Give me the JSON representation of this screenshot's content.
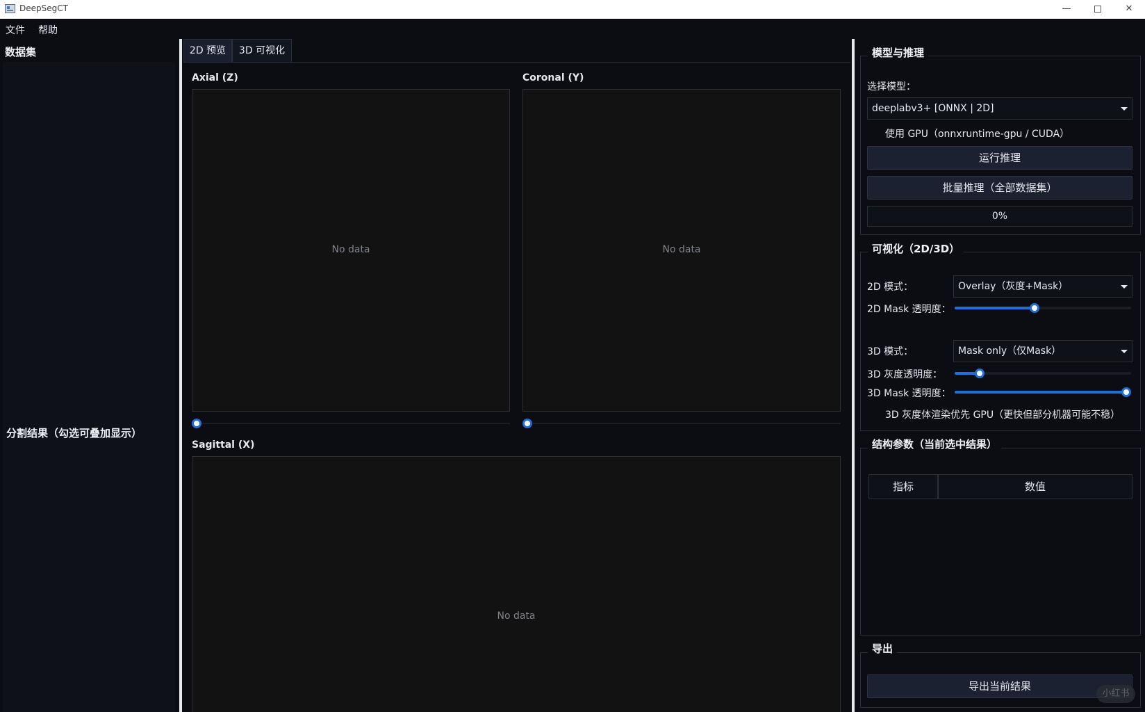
{
  "window": {
    "title": "DeepSegCT",
    "minimize": "—",
    "close": "✕"
  },
  "menu": {
    "file": "文件",
    "help": "帮助"
  },
  "left": {
    "dataset_title": "数据集",
    "results_title": "分割结果（勾选可叠加显示）"
  },
  "center": {
    "tabs": [
      {
        "label": "2D 预览",
        "active": true
      },
      {
        "label": "3D 可视化",
        "active": false
      }
    ],
    "views": {
      "axial": {
        "label": "Axial (Z)",
        "placeholder": "No data"
      },
      "coronal": {
        "label": "Coronal (Y)",
        "placeholder": "No data"
      },
      "sagittal": {
        "label": "Sagittal (X)",
        "placeholder": "No data"
      }
    }
  },
  "right": {
    "model_group": {
      "title": "模型与推理",
      "select_label": "选择模型：",
      "model_value": "deeplabv3+  [ONNX | 2D]",
      "gpu_label": "使用 GPU（onnxruntime-gpu / CUDA）",
      "gpu_checked": false,
      "run_button": "运行推理",
      "batch_button": "批量推理（全部数据集）",
      "progress": "0%"
    },
    "vis_group": {
      "title": "可视化（2D/3D）",
      "mode2d_label": "2D 模式：",
      "mode2d_value": "Overlay（灰度+Mask）",
      "mask2d_label": "2D Mask 透明度：",
      "mask2d_level": 0.45,
      "mode3d_label": "3D 模式：",
      "mode3d_value": "Mask only（仅Mask）",
      "gray3d_label": "3D 灰度透明度：",
      "gray3d_level": 0.12,
      "mask3d_label": "3D Mask 透明度：",
      "mask3d_level": 1.0,
      "gpu_render_label": "3D 灰度体渲染优先 GPU（更快但部分机器可能不稳）",
      "gpu_render_checked": false
    },
    "struct_group": {
      "title": "结构参数（当前选中结果）",
      "columns": [
        "指标",
        "数值"
      ]
    },
    "export_group": {
      "title": "导出",
      "export_button": "导出当前结果"
    }
  },
  "watermark": "小红书",
  "colors": {
    "accent": "#1e6fd9",
    "background": "#0b0d13",
    "panel": "#121212"
  }
}
